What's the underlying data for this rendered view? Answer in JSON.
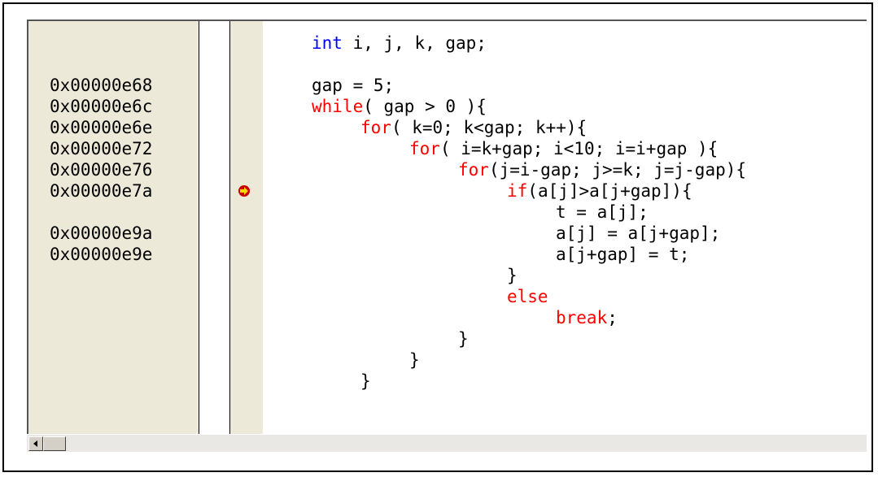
{
  "addresses": [
    {
      "line": 2,
      "text": "0x00000e68"
    },
    {
      "line": 3,
      "text": "0x00000e6c"
    },
    {
      "line": 4,
      "text": "0x00000e6e"
    },
    {
      "line": 5,
      "text": "0x00000e72"
    },
    {
      "line": 6,
      "text": "0x00000e76"
    },
    {
      "line": 7,
      "text": "0x00000e7a"
    },
    {
      "line": 9,
      "text": "0x00000e9a"
    },
    {
      "line": 10,
      "text": "0x00000e9e"
    }
  ],
  "code": [
    {
      "line": 0,
      "indent": 0,
      "parts": [
        {
          "t": "int",
          "c": "blue"
        },
        {
          "t": " i, j, k, gap;",
          "c": "black"
        }
      ]
    },
    {
      "line": 2,
      "indent": 0,
      "parts": [
        {
          "t": "gap = 5;",
          "c": "black"
        }
      ]
    },
    {
      "line": 3,
      "indent": 0,
      "parts": [
        {
          "t": "while",
          "c": "red"
        },
        {
          "t": "( gap > 0 ){",
          "c": "black"
        }
      ]
    },
    {
      "line": 4,
      "indent": 1,
      "parts": [
        {
          "t": "for",
          "c": "red"
        },
        {
          "t": "( k=0; k<gap; k++){",
          "c": "black"
        }
      ]
    },
    {
      "line": 5,
      "indent": 2,
      "parts": [
        {
          "t": "for",
          "c": "red"
        },
        {
          "t": "( i=k+gap; i<10; i=i+gap ){",
          "c": "black"
        }
      ]
    },
    {
      "line": 6,
      "indent": 3,
      "parts": [
        {
          "t": "for",
          "c": "red"
        },
        {
          "t": "(j=i-gap; j>=k; j=j-gap){",
          "c": "black"
        }
      ]
    },
    {
      "line": 7,
      "indent": 4,
      "parts": [
        {
          "t": "if",
          "c": "red"
        },
        {
          "t": "(a[j]>a[j+gap]){",
          "c": "black"
        }
      ]
    },
    {
      "line": 8,
      "indent": 5,
      "parts": [
        {
          "t": "t = a[j];",
          "c": "black"
        }
      ]
    },
    {
      "line": 9,
      "indent": 5,
      "parts": [
        {
          "t": "a[j] = a[j+gap];",
          "c": "black"
        }
      ]
    },
    {
      "line": 10,
      "indent": 5,
      "parts": [
        {
          "t": "a[j+gap] = t;",
          "c": "black"
        }
      ]
    },
    {
      "line": 11,
      "indent": 4,
      "parts": [
        {
          "t": "}",
          "c": "black"
        }
      ]
    },
    {
      "line": 12,
      "indent": 4,
      "parts": [
        {
          "t": "else",
          "c": "red"
        }
      ]
    },
    {
      "line": 13,
      "indent": 5,
      "parts": [
        {
          "t": "break",
          "c": "red"
        },
        {
          "t": ";",
          "c": "black"
        }
      ]
    },
    {
      "line": 14,
      "indent": 3,
      "parts": [
        {
          "t": "}",
          "c": "black"
        }
      ]
    },
    {
      "line": 15,
      "indent": 2,
      "parts": [
        {
          "t": "}",
          "c": "black"
        }
      ]
    },
    {
      "line": 16,
      "indent": 1,
      "parts": [
        {
          "t": "}",
          "c": "black"
        }
      ]
    }
  ],
  "current_pc_line": 7,
  "icons": {
    "pc_marker": "current-line-arrow-icon",
    "scroll_left": "scroll-left-arrow-icon"
  },
  "colors": {
    "keyword_blue": "#0000ff",
    "keyword_red": "#ff0000",
    "gutter_bg": "#ece9d8",
    "pc_marker_fill": "#ffd700",
    "pc_marker_border": "#cc0000"
  }
}
